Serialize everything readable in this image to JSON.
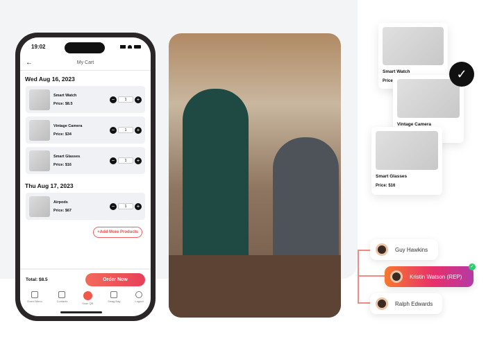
{
  "phone": {
    "time": "19:02",
    "title": "My Cart",
    "groups": [
      {
        "date": "Wed Aug 16, 2023",
        "items": [
          {
            "name": "Smart Watch",
            "price": "Price: $8.5",
            "qty": "1"
          },
          {
            "name": "Vintage Camera",
            "price": "Price: $34",
            "qty": "1"
          },
          {
            "name": "Smart Glasses",
            "price": "Price: $16",
            "qty": "1"
          }
        ]
      },
      {
        "date": "Thu Aug 17, 2023",
        "items": [
          {
            "name": "Airpods",
            "price": "Price: $67",
            "qty": "1"
          }
        ]
      }
    ],
    "add_more": "+Add More Products",
    "total": "Total: $8.5",
    "order": "Order Now",
    "tabs": [
      "Event Menu",
      "Contacts",
      "Scan QR",
      "Swag Bag",
      "Logout"
    ]
  },
  "cards": [
    {
      "name": "Smart Watch",
      "price": "Price"
    },
    {
      "name": "Vintage Camera"
    },
    {
      "name": "Smart Glasses",
      "price": "Price: $16"
    }
  ],
  "people": [
    "Guy Hawkins",
    "Kristin Watson (REP)",
    "Ralph Edwards"
  ],
  "colors": {
    "accent": "#f0584a",
    "rep_gradient": [
      "#f7782e",
      "#e6306a",
      "#b43aa6"
    ]
  }
}
